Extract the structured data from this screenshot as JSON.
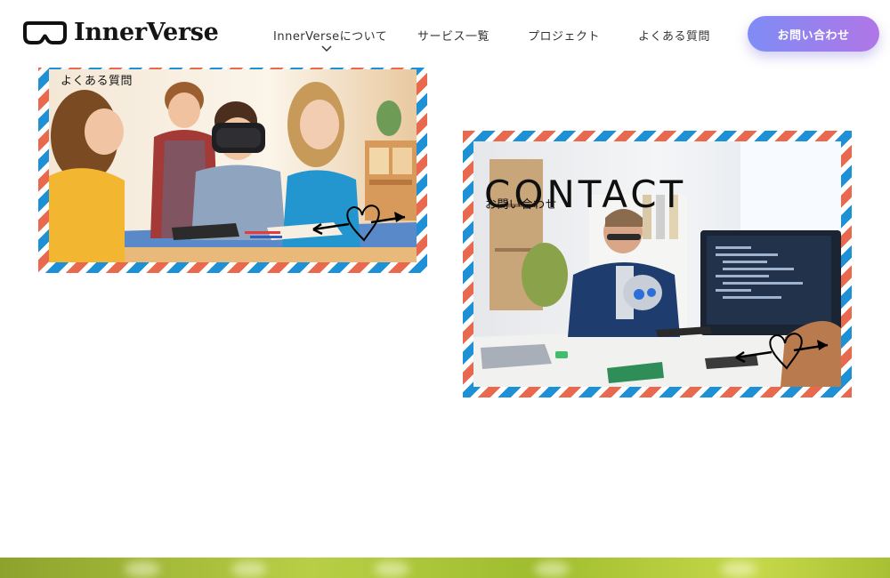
{
  "header": {
    "logo_text": "InnerVerse",
    "nav": [
      {
        "label": "InnerVerseについて"
      },
      {
        "label": "サービス一覧"
      },
      {
        "label": "プロジェクト"
      },
      {
        "label": "よくある質問"
      }
    ],
    "cta_label": "お問い合わせ"
  },
  "cards": {
    "faq": {
      "label": "よくある質問"
    },
    "contact": {
      "title": "CONTACT",
      "subtitle": "お問い合わせ"
    }
  },
  "colors": {
    "airmail_red": "#e8694e",
    "airmail_blue": "#1e90d6",
    "cta_gradient_start": "#7f8cf5",
    "cta_gradient_end": "#b076e6"
  },
  "icons": {
    "logo": "vr-headset-icon",
    "nav_dropdown": "chevron-down-icon",
    "card_decoration": "heart-arrow-icon"
  }
}
